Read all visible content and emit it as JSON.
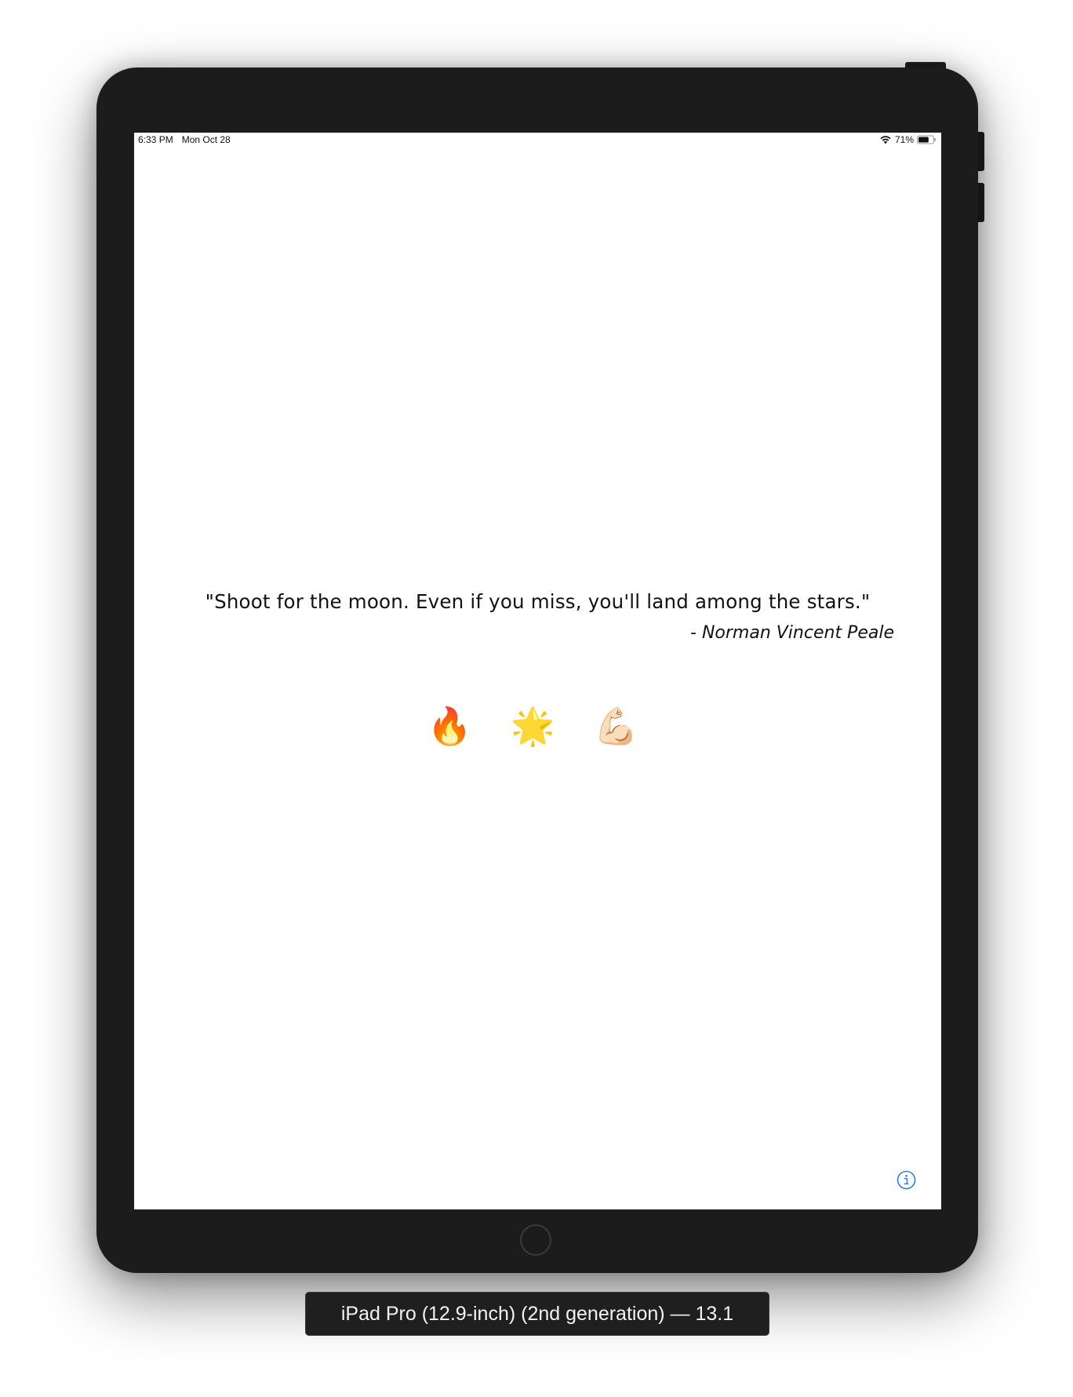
{
  "status_bar": {
    "time": "6:33 PM",
    "date": "Mon Oct 28",
    "battery_percent": "71%",
    "battery_level": 0.71,
    "wifi_icon": "wifi-icon",
    "battery_icon": "battery-icon"
  },
  "content": {
    "quote": "\"Shoot for the moon. Even if you miss, you'll land among the stars.\"",
    "author": "- Norman Vincent Peale",
    "emojis": [
      "🔥",
      "🌟",
      "💪🏻"
    ],
    "info_icon": "info-icon"
  },
  "device": {
    "caption": "iPad Pro (12.9-inch) (2nd generation) — 13.1",
    "home_button_icon": "home-button"
  },
  "colors": {
    "accent": "#2f7cf6",
    "bezel": "#1c1c1c",
    "screen": "#ffffff",
    "text": "#111111"
  }
}
